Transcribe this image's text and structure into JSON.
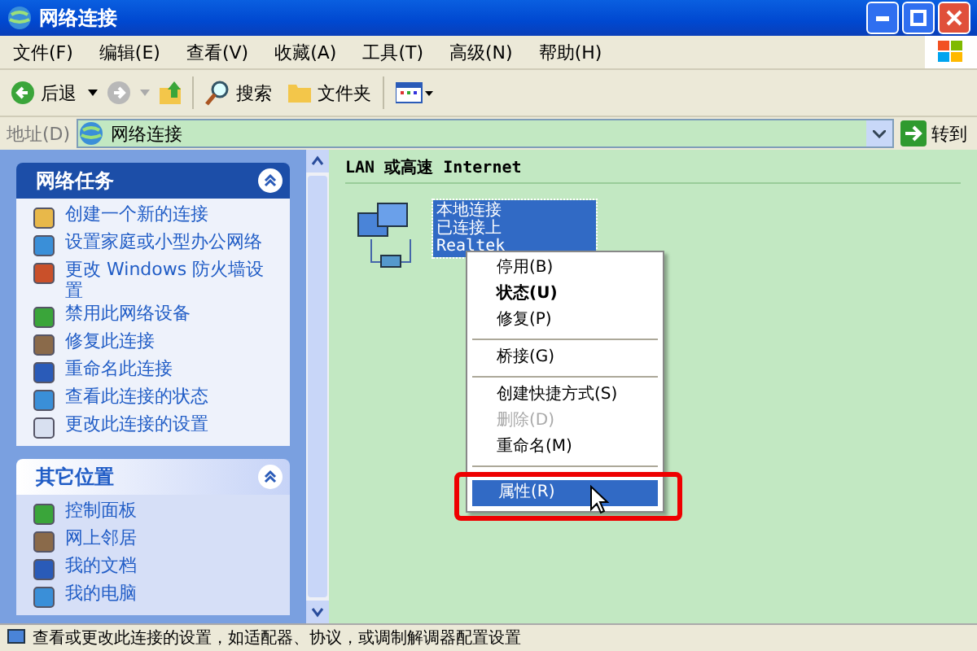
{
  "window": {
    "title": "网络连接"
  },
  "menu_bar": [
    "文件(F)",
    "编辑(E)",
    "查看(V)",
    "收藏(A)",
    "工具(T)",
    "高级(N)",
    "帮助(H)"
  ],
  "toolbar": {
    "back": "后退",
    "search": "搜索",
    "folders": "文件夹"
  },
  "address_bar": {
    "label": "地址(D)",
    "value": "网络连接",
    "go": "转到"
  },
  "sidebar": {
    "panels": [
      {
        "title": "网络任务",
        "expanded": true,
        "items": [
          "创建一个新的连接",
          "设置家庭或小型办公网络",
          "更改 Windows 防火墙设置",
          "禁用此网络设备",
          "修复此连接",
          "重命名此连接",
          "查看此连接的状态",
          "更改此连接的设置"
        ]
      },
      {
        "title": "其它位置",
        "expanded": true,
        "items": [
          "控制面板",
          "网上邻居",
          "我的文档",
          "我的电脑"
        ]
      }
    ]
  },
  "content": {
    "group_heading": "LAN 或高速 Internet",
    "connection": {
      "name": "本地连接",
      "status": "已连接上",
      "device": "Realtek",
      "selected": true
    }
  },
  "context_menu": [
    {
      "kind": "item",
      "label": "停用(B)",
      "bold": false,
      "disabled": false,
      "selected": false
    },
    {
      "kind": "item",
      "label": "状态(U)",
      "bold": true,
      "disabled": false,
      "selected": false
    },
    {
      "kind": "item",
      "label": "修复(P)",
      "bold": false,
      "disabled": false,
      "selected": false
    },
    {
      "kind": "separator"
    },
    {
      "kind": "item",
      "label": "桥接(G)",
      "bold": false,
      "disabled": false,
      "selected": false
    },
    {
      "kind": "separator"
    },
    {
      "kind": "item",
      "label": "创建快捷方式(S)",
      "bold": false,
      "disabled": false,
      "selected": false
    },
    {
      "kind": "item",
      "label": "删除(D)",
      "bold": false,
      "disabled": true,
      "selected": false
    },
    {
      "kind": "item",
      "label": "重命名(M)",
      "bold": false,
      "disabled": false,
      "selected": false
    },
    {
      "kind": "separator"
    },
    {
      "kind": "item",
      "label": "属性(R)",
      "bold": false,
      "disabled": false,
      "selected": true
    }
  ],
  "status_bar": "查看或更改此连接的设置，如适配器、协议，或调制解调器配置设置"
}
